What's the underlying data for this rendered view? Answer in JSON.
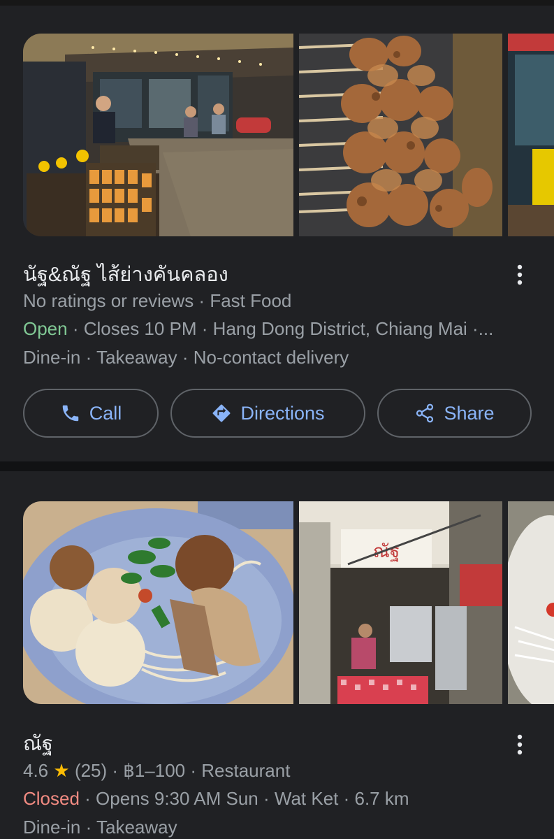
{
  "results": [
    {
      "name": "นัฐ&ณัฐ ไส้ย่างคันคลอง",
      "rating_text": "No ratings or reviews",
      "category": "Fast Food",
      "status": "Open",
      "hours": "Closes 10 PM",
      "location": "Hang Dong District, Chiang Mai ·...",
      "services": "Dine-in · Takeaway · No-contact delivery",
      "photos": [
        "street-food-stall-photo",
        "grilled-pork-skewers-photo",
        "shop-front-photo"
      ],
      "actions": [
        {
          "label": "Call",
          "icon": "phone-icon"
        },
        {
          "label": "Directions",
          "icon": "directions-icon"
        },
        {
          "label": "Share",
          "icon": "share-icon"
        }
      ]
    },
    {
      "name": "ณัฐ",
      "rating": "4.6",
      "review_count": "(25)",
      "price": "฿1–100",
      "category": "Restaurant",
      "status": "Closed",
      "hours": "Opens 9:30 AM Sun",
      "area": "Wat Ket",
      "distance": "6.7 km",
      "services": "Dine-in · Takeaway",
      "photos": [
        "noodle-soup-meatballs-photo",
        "shop-kitchen-photo",
        "dish-photo"
      ]
    }
  ],
  "colors": {
    "background": "#202124",
    "separator": "#111214",
    "accent": "#8ab4f8",
    "open": "#81c995",
    "closed": "#f28b82",
    "star": "#fbbc04",
    "secondary_text": "#9aa0a6"
  }
}
